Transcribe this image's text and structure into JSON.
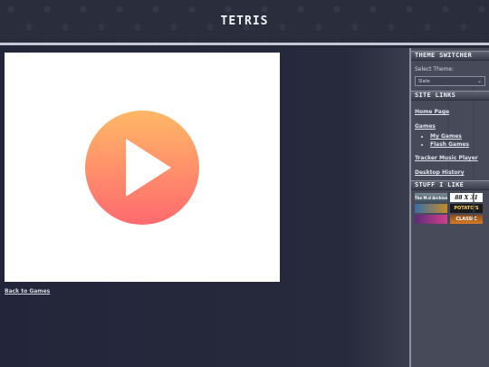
{
  "header": {
    "title": "TETRIS"
  },
  "main": {
    "back_link": "Back to Games"
  },
  "sidebar": {
    "theme_heading": "THEME SWITCHER",
    "theme_label": "Select Theme:",
    "theme_selected": "Slate",
    "links_heading": "SITE LINKS",
    "links": {
      "home": "Home Page",
      "games": "Games",
      "my_games": "My Games",
      "flash_games": "Flash Games",
      "tracker": "Tracker Music Player",
      "desktop": "Desktop History"
    },
    "stuff_heading": "STUFF I LIKE",
    "badges": {
      "b1": "The M.d Archive",
      "b2": "88 X 31",
      "b3": "",
      "b4": "POTATO'S",
      "b5": "",
      "b6": "CLASSIC"
    }
  },
  "colors": {
    "background": "#252838",
    "sidebar": "#474a59",
    "play_gradient_top": "#ffb866",
    "play_gradient_bottom": "#ff6a6f"
  }
}
